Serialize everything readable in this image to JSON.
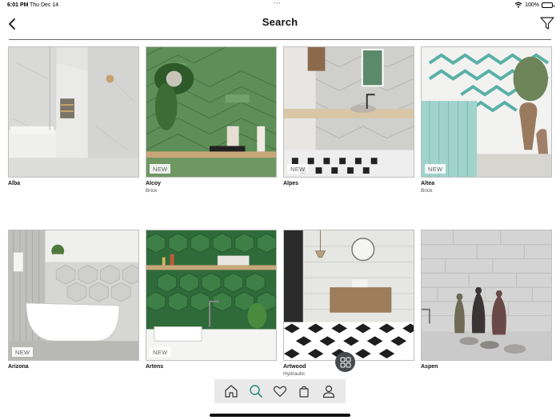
{
  "status_bar": {
    "time": "6:01 PM",
    "date": "Thu Dec 14",
    "battery": "100%",
    "battery_level": 1.0
  },
  "header": {
    "title": "Search"
  },
  "products": [
    {
      "name": "Alba",
      "subtitle": "",
      "badge": ""
    },
    {
      "name": "Alcoy",
      "subtitle": "Brick",
      "badge": "NEW"
    },
    {
      "name": "Alpes",
      "subtitle": "",
      "badge": "NEW"
    },
    {
      "name": "Altea",
      "subtitle": "Brick",
      "badge": "NEW"
    },
    {
      "name": "Arizona",
      "subtitle": "",
      "badge": "NEW"
    },
    {
      "name": "Artens",
      "subtitle": "",
      "badge": "NEW"
    },
    {
      "name": "Artwood",
      "subtitle": "Hydraulic",
      "badge": ""
    },
    {
      "name": "Aspen",
      "subtitle": "",
      "badge": ""
    }
  ],
  "tab_bar": {
    "tabs": [
      "home-icon",
      "search-icon",
      "heart-icon",
      "bag-icon",
      "user-icon"
    ],
    "active_tab": "search-icon",
    "active_color": "#1f8a7a"
  }
}
